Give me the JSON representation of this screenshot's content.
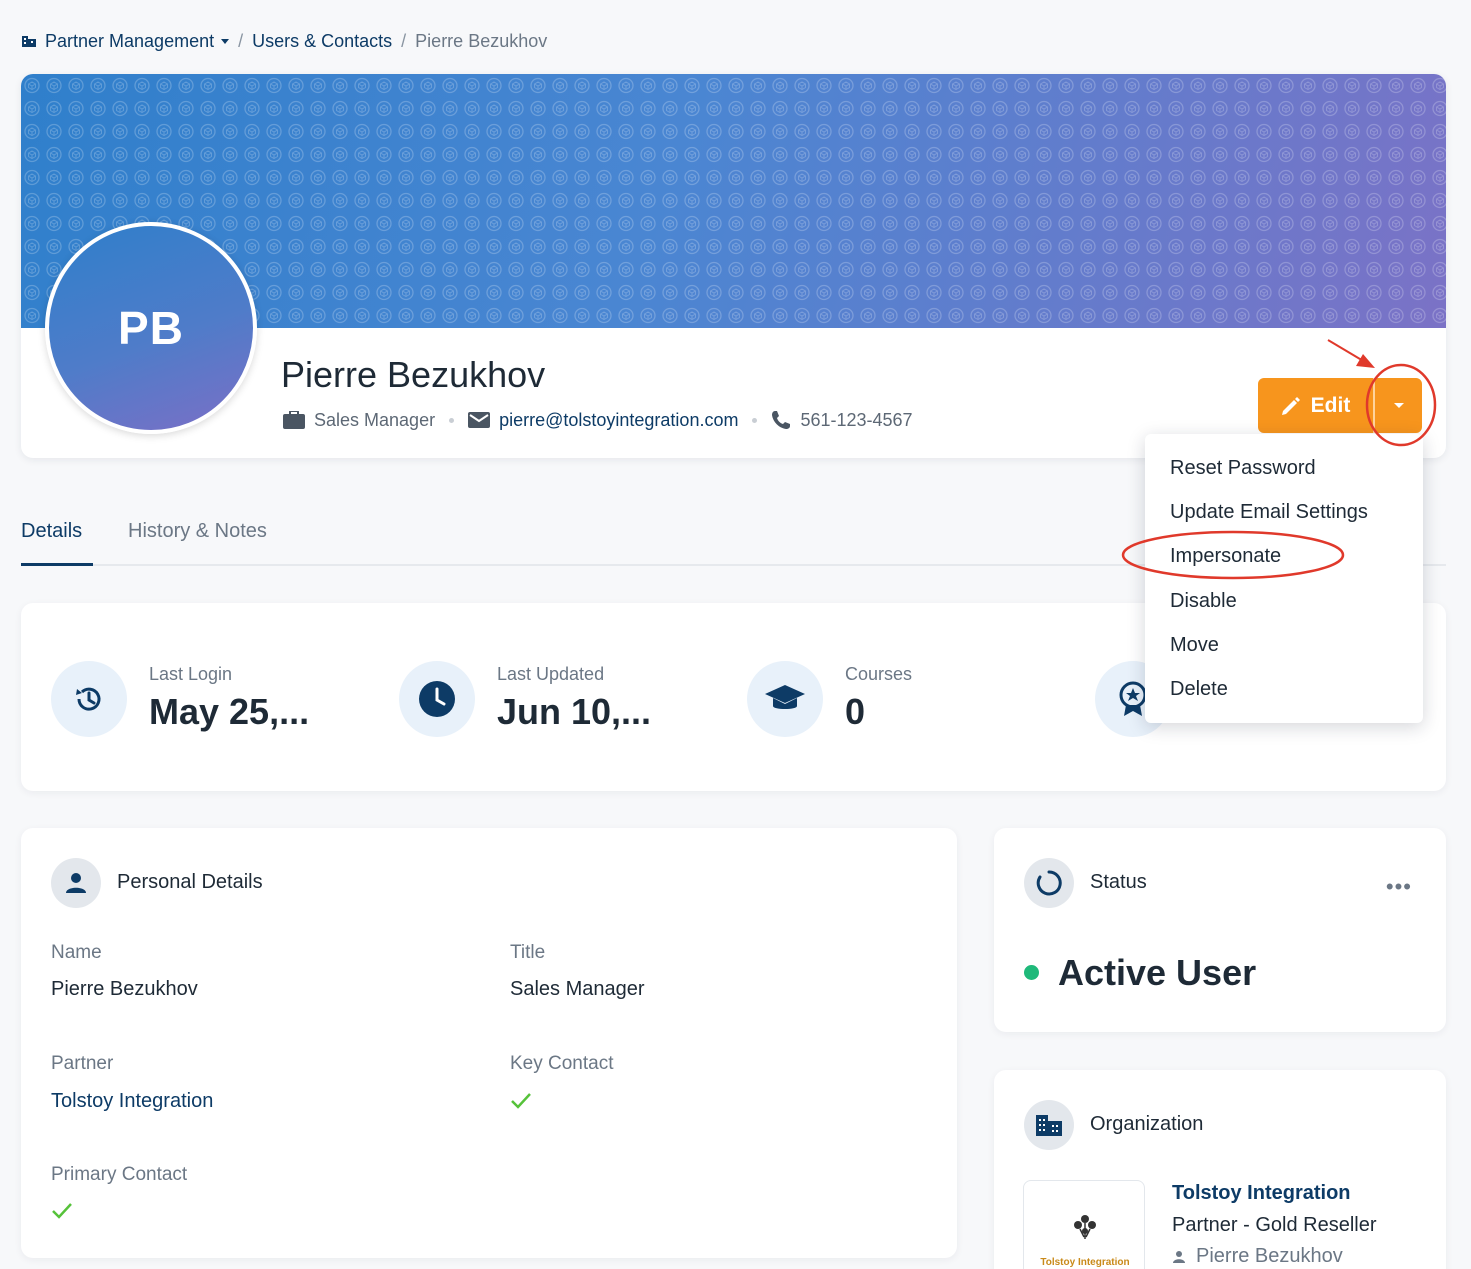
{
  "breadcrumb": {
    "root": "Partner Management",
    "section": "Users & Contacts",
    "current": "Pierre Bezukhov",
    "separator": "/"
  },
  "profile": {
    "initials": "PB",
    "name": "Pierre Bezukhov",
    "title": "Sales Manager",
    "email": "pierre@tolstoyintegration.com",
    "phone": "561-123-4567"
  },
  "actions": {
    "edit_label": "Edit",
    "menu": [
      "Reset Password",
      "Update Email Settings",
      "Impersonate",
      "Disable",
      "Move",
      "Delete"
    ]
  },
  "tabs": {
    "details": "Details",
    "history": "History & Notes"
  },
  "stats": {
    "last_login_label": "Last Login",
    "last_login_value": "May 25,...",
    "last_updated_label": "Last Updated",
    "last_updated_value": "Jun 10,...",
    "courses_label": "Courses",
    "courses_value": "0"
  },
  "personal": {
    "title": "Personal Details",
    "name_label": "Name",
    "name_value": "Pierre Bezukhov",
    "title_label": "Title",
    "title_value": "Sales Manager",
    "partner_label": "Partner",
    "partner_value": "Tolstoy Integration",
    "key_contact_label": "Key Contact",
    "key_contact": true,
    "primary_contact_label": "Primary Contact",
    "primary_contact": true
  },
  "status": {
    "title": "Status",
    "value": "Active User",
    "color": "#1fb97a"
  },
  "organization": {
    "title": "Organization",
    "logo_text": "Tolstoy Integration",
    "name": "Tolstoy Integration",
    "type": "Partner - Gold Reseller",
    "contact": "Pierre Bezukhov"
  },
  "colors": {
    "accent": "#f7951d",
    "primary": "#0d3b66",
    "annotation": "#e0392b"
  }
}
